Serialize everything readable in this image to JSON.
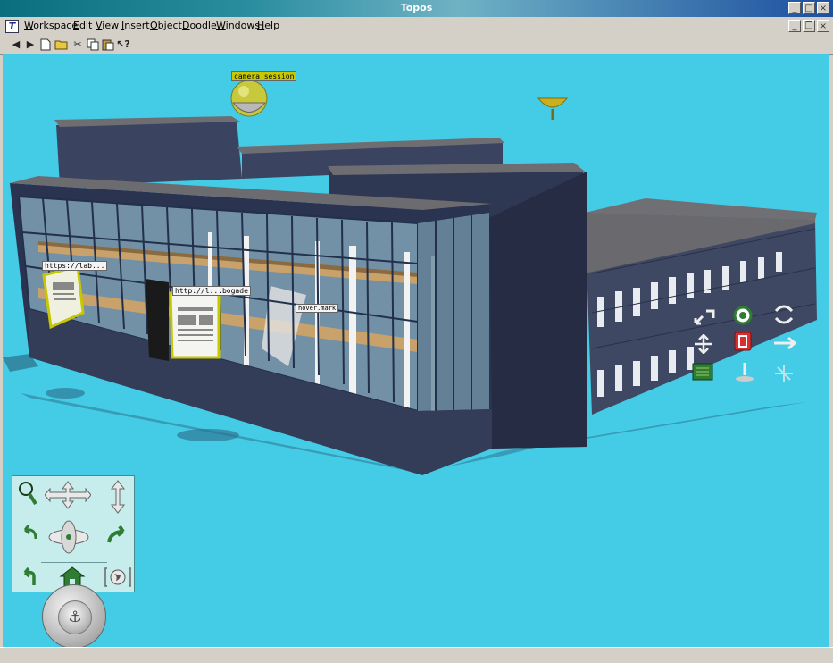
{
  "window": {
    "title": "Topos"
  },
  "menubar": {
    "items": [
      "Workspace",
      "Edit",
      "View",
      "Insert",
      "Object",
      "Doodle",
      "Windows",
      "Help"
    ]
  },
  "toolbar": {
    "icons": [
      "back-arrow-icon",
      "forward-arrow-icon",
      "new-document-icon",
      "open-folder-icon",
      "cut-icon",
      "copy-icon",
      "paste-icon",
      "context-help-icon"
    ]
  },
  "scene": {
    "sphere_label": "camera_session",
    "poster_left_label": "https://lab...",
    "poster_right_label": "http://l...bogade",
    "center_label": "hover.mark"
  },
  "colors": {
    "viewport_bg": "#44cbe6",
    "building_dark": "#3a4460",
    "roof": "#6e6e72",
    "glass": "#7fa2b6",
    "floor_wood": "#c8a26a",
    "accent_yellow": "#c8c800",
    "nav_panel_bg": "#c6ecec",
    "nav_icon_green": "#2e7d32"
  },
  "navigation": {
    "icons": [
      "zoom-magnifier-icon",
      "pan-four-way-arrows-icon",
      "vertical-move-arrows-icon",
      "rotate-left-icon",
      "orbit-icon",
      "turn-right-icon",
      "back-turn-icon",
      "home-icon",
      "world-view-icon"
    ],
    "dial_icon": "anchor-icon"
  },
  "manipulators": {
    "icons": [
      "scale-arrows-icon",
      "target-icon",
      "rotate-object-icon",
      "move-vertical-icon",
      "delete-object-icon",
      "move-horizontal-icon",
      "properties-icon",
      "stand-icon",
      "move-3d-icon"
    ]
  }
}
